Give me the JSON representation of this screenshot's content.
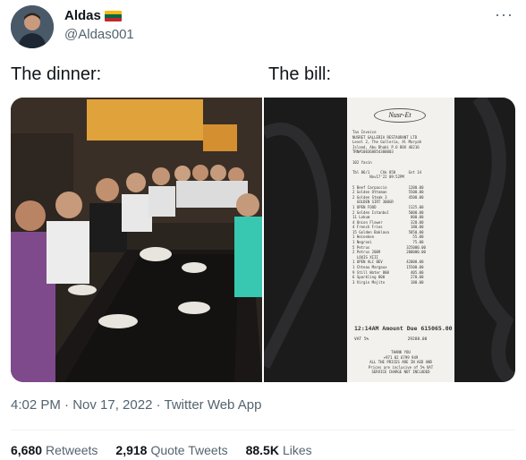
{
  "author": {
    "display_name": "Aldas",
    "flag": "lithuania-flag",
    "flag_colors": [
      "#FDB913",
      "#006A44",
      "#C1272D"
    ],
    "handle": "@Aldas001"
  },
  "more_icon": "more-icon",
  "captions": {
    "left": "The dinner:",
    "right": "The bill:"
  },
  "receipt": {
    "logo": "Nusr-Et",
    "header_lines": "Tax Invoice\nNUSRET GALLERIA RESTAURANT LTD\nLevel 2, The Galleria, Al Maryah\nIsland, Abu Dhabi P.O BOX 46216\nTRN#100368854300003\n\n102 Yasin\n\nTbl 86/1     Chk 850      Gst 14\n        Nov17'22 09:52PM\n\n5 Beef Carpaccio          1200.00\n2 Golden Ottoman          5500.00\n2 Golden Steak 3          4500.00\n  GOLDEN SIRT 300GR\n1 OPEN FOOD               1125.00\n2 Golden Istanbul         5000.00\n11 Lokum                   800.00\n4 Onion Flower             320.00\n4 French Fries             180.00\n15 Golden Baklava         5850.00\n1 Heineken                  55.00\n1 Negroni                   75.00\n5 Petrus                 325000.00\n2 Petrus 2009            200000.00\n  LOUIS XIII\n1 OPEN ALC BEV           42000.00\n1 Chteau Margaux         15500.00\n9 Still Water 800          405.00\n6 Sparkling 800            270.00\n3 Virgin Mojito            180.00",
    "amount_line": "12:14AM Amount Due 615065.00",
    "vat_line": "VAT 5%                29288.00",
    "footer_lines": "THANK YOU\n+971 02 6799 949\nALL THE PRICES ARE IN AED AND\nPrices are inclusive of 5% VAT\nSERVICE CHARGE NOT INCLUDED"
  },
  "timestamp": "4:02 PM · Nov 17, 2022 · Twitter Web App",
  "stats": {
    "retweets_count": "6,680",
    "retweets_label": "Retweets",
    "quotes_count": "2,918",
    "quotes_label": "Quote Tweets",
    "likes_count": "88.5K",
    "likes_label": "Likes"
  }
}
